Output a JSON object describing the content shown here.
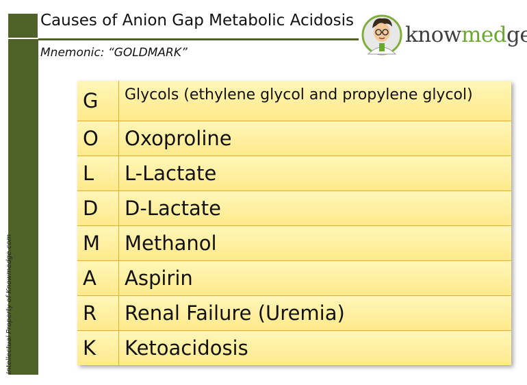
{
  "title": "Causes of Anion Gap Metabolic Acidosis",
  "subtitle": "Mnemonic: “GOLDMARK”",
  "side_text": "Intellectual Property of Knowmedge.com",
  "logo": {
    "icon": "doctor-avatar-icon",
    "text_part1": "know",
    "text_part2": "med",
    "text_part3": "ge"
  },
  "colors": {
    "accent_green": "#4f6228",
    "cell_yellow": "#ffeb94",
    "cell_border": "#e3b13a",
    "logo_green": "#6aa82e"
  },
  "rows": [
    {
      "letter": "G",
      "cause": "Glycols (ethylene glycol and propylene glycol)"
    },
    {
      "letter": "O",
      "cause": "Oxoproline"
    },
    {
      "letter": "L",
      "cause": "L-Lactate"
    },
    {
      "letter": "D",
      "cause": "D-Lactate"
    },
    {
      "letter": "M",
      "cause": "Methanol"
    },
    {
      "letter": "A",
      "cause": "Aspirin"
    },
    {
      "letter": "R",
      "cause": "Renal Failure (Uremia)"
    },
    {
      "letter": "K",
      "cause": "Ketoacidosis"
    }
  ]
}
